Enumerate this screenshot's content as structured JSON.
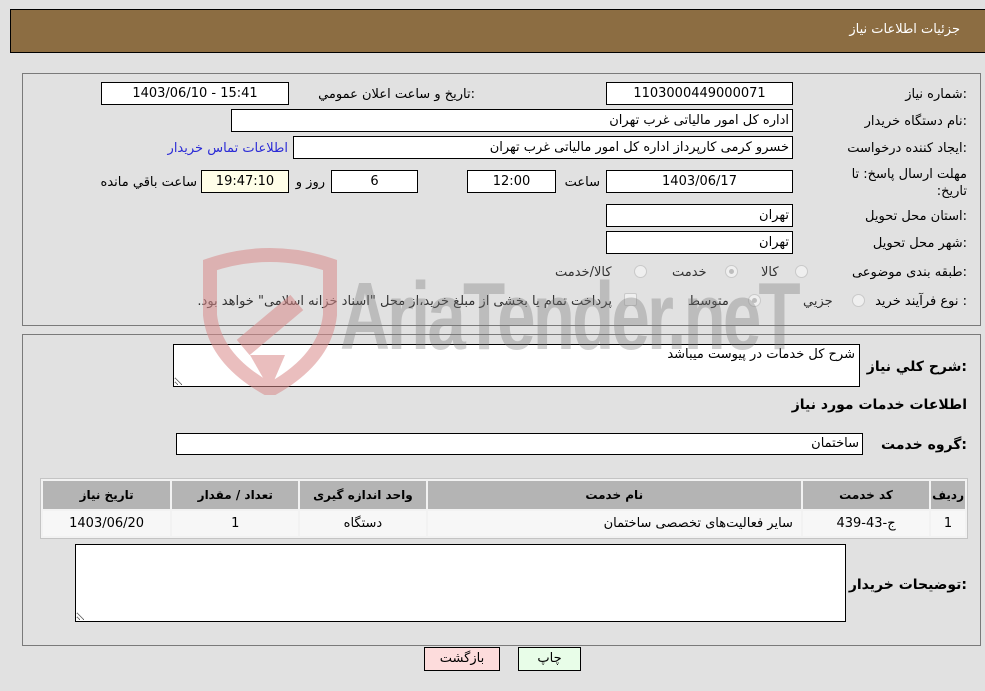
{
  "header": {
    "title": "جزئیات اطلاعات نیاز"
  },
  "details": {
    "need_number": {
      "label": "شماره نیاز:",
      "value": "1103000449000071"
    },
    "announce_datetime": {
      "label": "تاریخ و ساعت اعلان عمومي:",
      "value": "1403/06/10 - 15:41"
    },
    "buyer_org": {
      "label": "نام دستگاه خریدار:",
      "value": "اداره کل امور مالیاتی غرب تهران"
    },
    "requester": {
      "label": "ایجاد کننده درخواست:",
      "value": "خسرو کرمی کارپرداز اداره کل امور مالیاتی غرب تهران"
    },
    "buyer_contact_link": "اطلاعات تماس خریدار",
    "deadline": {
      "label": "مهلت ارسال پاسخ: تا تاریخ:",
      "date": "1403/06/17",
      "time_label": "ساعت",
      "time": "12:00",
      "days": "6",
      "days_label": "روز و",
      "remaining": "19:47:10",
      "remaining_label": "ساعت باقي مانده"
    },
    "province": {
      "label": "استان محل تحویل:",
      "value": "تهران"
    },
    "city": {
      "label": "شهر محل تحویل:",
      "value": "تهران"
    },
    "category": {
      "label": "طبقه بندی موضوعی:",
      "options": [
        "کالا",
        "خدمت",
        "کالا/خدمت"
      ],
      "selected": "خدمت"
    },
    "purchase_type": {
      "label": "نوع فرآیند خرید :",
      "options": [
        "جزيي",
        "متوسط"
      ],
      "selected": "متوسط",
      "treasury_checkbox_label": "پرداخت تمام یا بخشی از مبلغ خرید،از محل \"اسناد خزانه اسلامی\" خواهد بود.",
      "treasury_checked": false
    }
  },
  "description": {
    "label": "شرح کلي نیاز:",
    "value": "شرح کل خدمات در پیوست میباشد"
  },
  "services_section_title": "اطلاعات خدمات مورد نیاز",
  "service_group": {
    "label": "گروه خدمت:",
    "value": "ساختمان"
  },
  "services_table": {
    "headers": [
      "ردیف",
      "کد خدمت",
      "نام خدمت",
      "واحد اندازه گیری",
      "تعداد / مقدار",
      "تاریخ نیاز"
    ],
    "rows": [
      [
        "1",
        "ج-43-439",
        "سایر فعالیت‌های تخصصی ساختمان",
        "دستگاه",
        "1",
        "1403/06/20"
      ]
    ]
  },
  "buyer_notes": {
    "label": "توضیحات خریدار:",
    "value": ""
  },
  "buttons": {
    "print": "چاپ",
    "back": "بازگشت"
  },
  "watermark": {
    "text": "AriaTender.neT"
  }
}
